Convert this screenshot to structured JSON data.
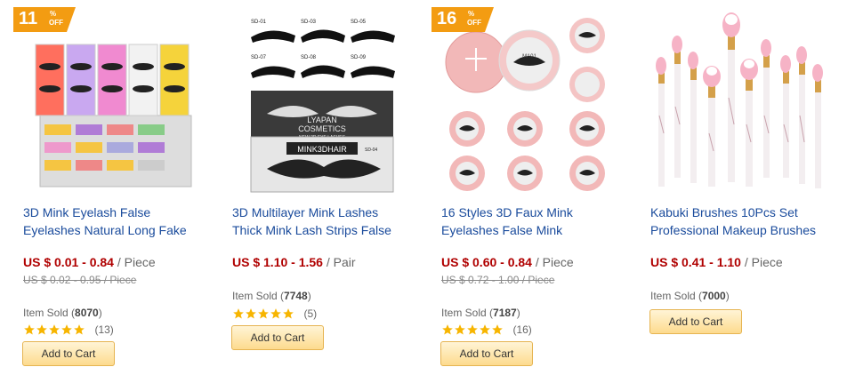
{
  "colors": {
    "badge": "#f39c12",
    "price": "#b00000",
    "link": "#1a4b9c",
    "star": "#f7b500"
  },
  "products": [
    {
      "badge": {
        "num": "11",
        "pct": "%",
        "off": "OFF"
      },
      "title_line1": "3D Mink Eyelash False",
      "title_line2": "Eyelashes Natural Long Fake",
      "price": "US $ 0.01 - 0.84",
      "unit": " / Piece",
      "old_price": "US $ 0.02 - 0.95 / Piece",
      "sold_label": "Item Sold (",
      "sold_count": "8070",
      "sold_close": ")",
      "rating": 5,
      "reviews": "(13)",
      "cart_label": "Add to Cart",
      "image": "lash-boxes-photo"
    },
    {
      "title_line1": "3D Multilayer Mink Lashes",
      "title_line2": "Thick Mink Lash Strips False",
      "price": "US $ 1.10 - 1.56",
      "unit": " / Pair",
      "sold_label": "Item Sold (",
      "sold_count": "7748",
      "sold_close": ")",
      "rating": 5,
      "reviews": "(5)",
      "cart_label": "Add to Cart",
      "image": "lash-strips-photo",
      "image_texts": [
        "SD-01",
        "SD-03",
        "SD-05",
        "SD-07",
        "SD-08",
        "SD-09",
        "LYAPAN",
        "COSMETICS",
        "NEW 3D EYE LASHES",
        "MINK3DHAIR",
        "SD-04"
      ]
    },
    {
      "badge": {
        "num": "16",
        "pct": "%",
        "off": "OFF"
      },
      "title_line1": "16 Styles 3D Faux Mink",
      "title_line2": "Eyelashes False Mink",
      "price": "US $ 0.60 - 0.84",
      "unit": " / Piece",
      "old_price": "US $ 0.72 - 1.00 / Piece",
      "sold_label": "Item Sold (",
      "sold_count": "7187",
      "sold_close": ")",
      "rating": 5,
      "reviews": "(16)",
      "cart_label": "Add to Cart",
      "image": "pink-round-cases-photo",
      "image_texts": [
        "MA01"
      ]
    },
    {
      "title_line1": "Kabuki Brushes 10Pcs Set",
      "title_line2": "Professional Makeup Brushes",
      "price": "US $ 0.41 - 1.10",
      "unit": " / Piece",
      "sold_label": "Item Sold (",
      "sold_count": "7000",
      "sold_close": ")",
      "cart_label": "Add to Cart",
      "image": "makeup-brushes-photo"
    }
  ]
}
